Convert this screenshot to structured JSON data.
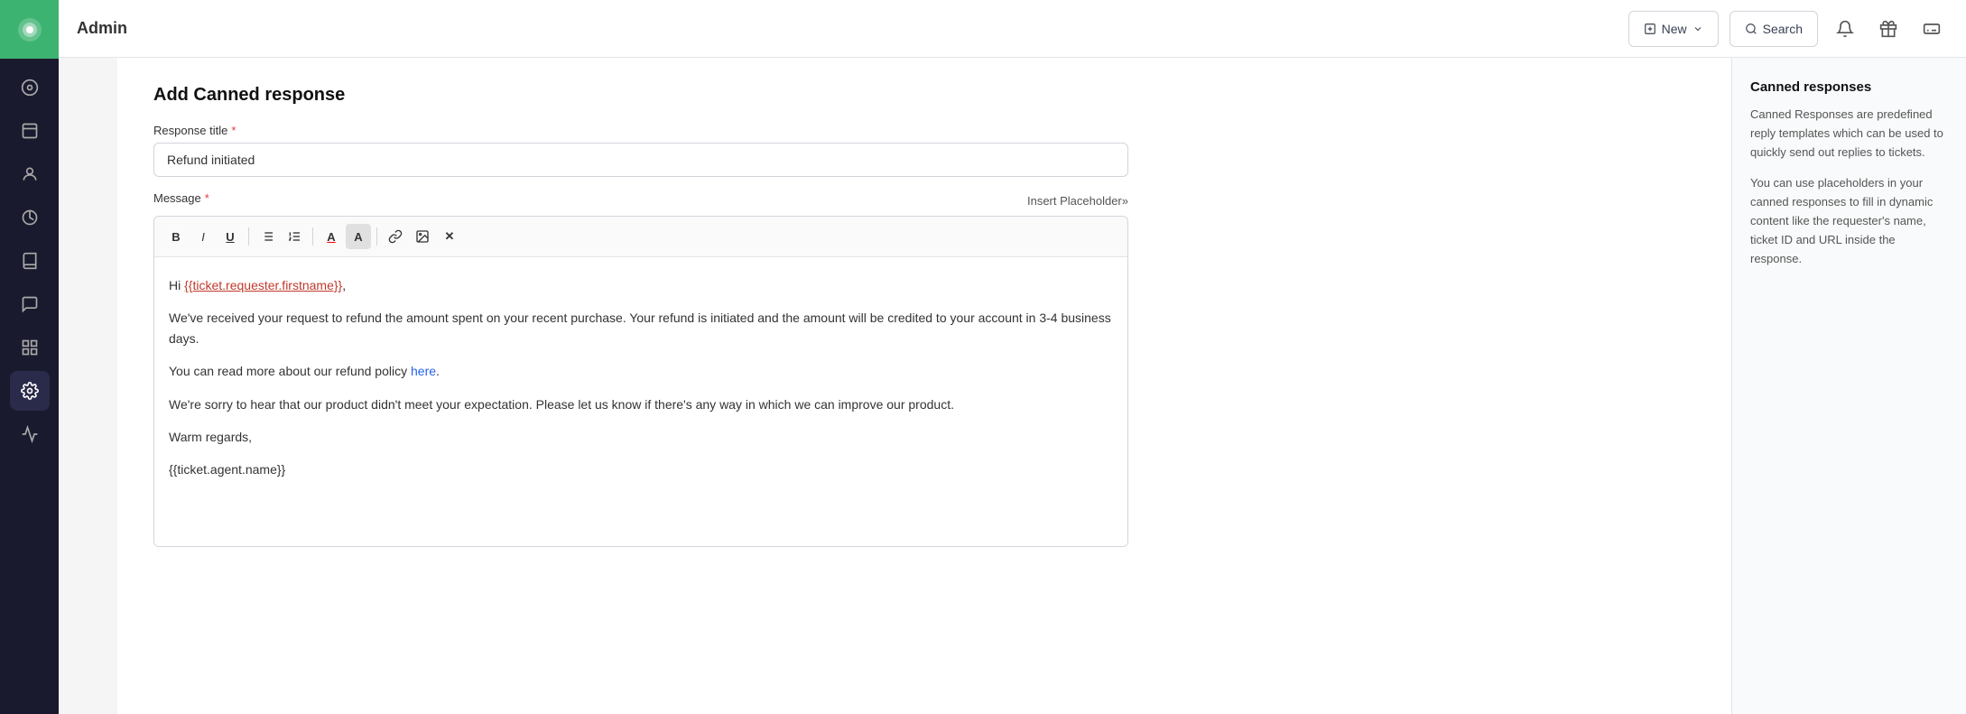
{
  "topbar": {
    "title": "Admin",
    "new_label": "New",
    "search_label": "Search"
  },
  "sidebar": {
    "logo_icon": "◉",
    "items": [
      {
        "id": "home",
        "icon": "⊙",
        "label": "Home"
      },
      {
        "id": "tickets",
        "icon": "☐",
        "label": "Tickets"
      },
      {
        "id": "contacts",
        "icon": "👤",
        "label": "Contacts"
      },
      {
        "id": "reports",
        "icon": "⎇",
        "label": "Reports"
      },
      {
        "id": "knowledge",
        "icon": "📖",
        "label": "Knowledge"
      },
      {
        "id": "conversations",
        "icon": "💬",
        "label": "Conversations"
      },
      {
        "id": "groups",
        "icon": "⊞",
        "label": "Groups"
      },
      {
        "id": "settings",
        "icon": "⚙",
        "label": "Settings",
        "active": true
      },
      {
        "id": "analytics",
        "icon": "📈",
        "label": "Analytics"
      }
    ]
  },
  "page": {
    "title": "Add Canned response",
    "response_title_label": "Response title",
    "response_title_required": true,
    "response_title_value": "Refund initiated",
    "message_label": "Message",
    "message_required": true,
    "insert_placeholder_btn": "Insert Placeholder»"
  },
  "editor": {
    "toolbar": [
      {
        "id": "bold",
        "label": "B",
        "type": "bold"
      },
      {
        "id": "italic",
        "label": "I",
        "type": "italic"
      },
      {
        "id": "underline",
        "label": "U",
        "type": "underline"
      },
      {
        "id": "ul",
        "label": "≡",
        "type": "list"
      },
      {
        "id": "ol",
        "label": "≡",
        "type": "list-ordered"
      },
      {
        "id": "font-color",
        "label": "A",
        "type": "font-color"
      },
      {
        "id": "bg-color",
        "label": "A",
        "type": "bg-color"
      },
      {
        "id": "link",
        "label": "🔗",
        "type": "link"
      },
      {
        "id": "image",
        "label": "🖼",
        "type": "image"
      },
      {
        "id": "clear",
        "label": "✕",
        "type": "clear"
      }
    ],
    "content": {
      "greeting": "Hi ",
      "placeholder_name": "{{ticket.requester.firstname}}",
      "greeting_end": ",",
      "body1": "We've received your request to refund the amount spent on your recent purchase. Your refund is initiated and the amount will be credited to your account in 3-4 business days.",
      "body2_prefix": "You can read more about our refund policy ",
      "body2_link": "here",
      "body2_suffix": ".",
      "body3": "We're sorry to hear that our product didn't meet your expectation. Please let us know if there's any way in which we can improve our product.",
      "closing": "Warm regards,",
      "agent_placeholder": "{{ticket.agent.name}}"
    }
  },
  "right_panel": {
    "title": "Canned responses",
    "description1": "Canned Responses are predefined reply templates which can be used to quickly send out replies to tickets.",
    "description2": "You can use placeholders in your canned responses to fill in dynamic content like the requester's name, ticket ID and URL inside the response."
  }
}
